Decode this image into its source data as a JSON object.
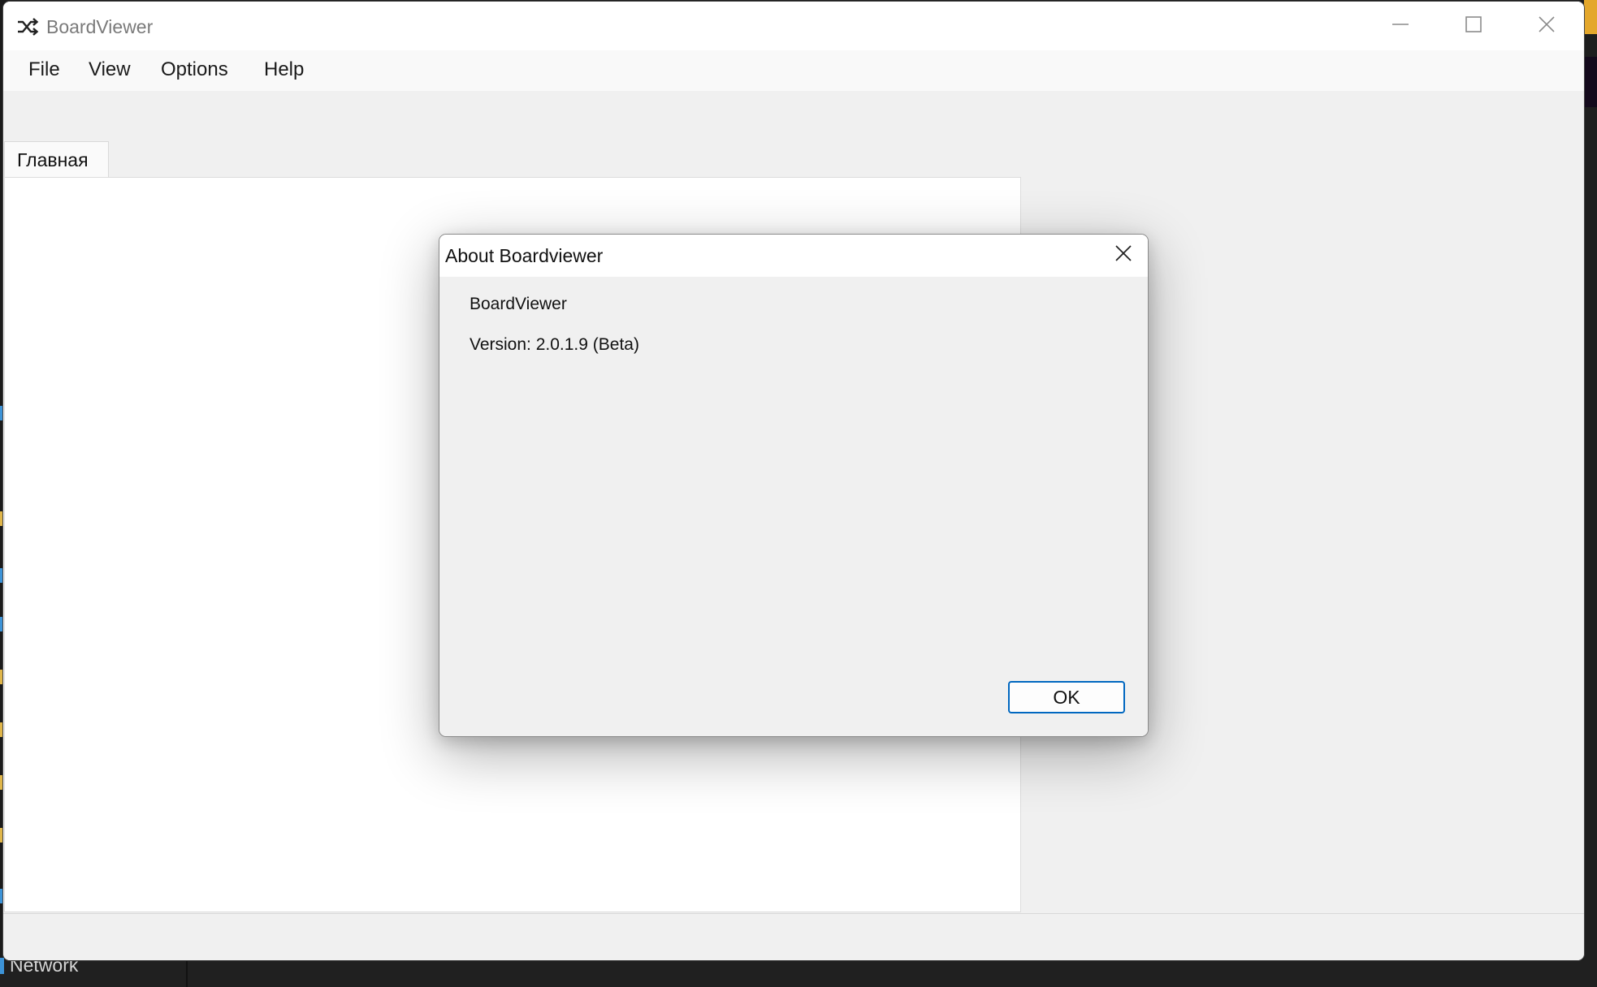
{
  "window": {
    "title": "BoardViewer",
    "controls": {
      "minimize": "minimize-icon",
      "maximize": "maximize-icon",
      "close": "close-icon"
    }
  },
  "menu": {
    "items": [
      {
        "label": "File"
      },
      {
        "label": "View"
      },
      {
        "label": "Options"
      },
      {
        "label": "Help"
      }
    ]
  },
  "tabs": [
    {
      "label": "Главная",
      "selected": true
    }
  ],
  "dialog": {
    "title": "About Boardviewer",
    "app_name": "BoardViewer",
    "version": "Version: 2.0.1.9 (Beta)",
    "ok_label": "OK"
  },
  "background": {
    "taskbar_label": "Network"
  },
  "colors": {
    "accent": "#0067c0",
    "window_bg": "#f0f0f0",
    "titlebar_bg": "#ffffff"
  }
}
